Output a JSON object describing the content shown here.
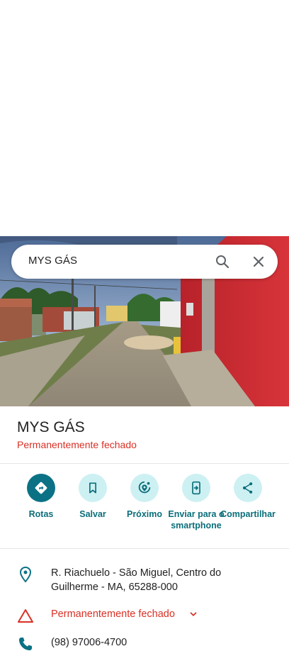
{
  "search": {
    "query": "MYS GÁS"
  },
  "place": {
    "name": "MYS GÁS",
    "status": "Permanentemente fechado"
  },
  "actions": [
    {
      "label": "Rotas",
      "icon": "directions-icon"
    },
    {
      "label": "Salvar",
      "icon": "bookmark-icon"
    },
    {
      "label": "Próximo",
      "icon": "nearby-icon"
    },
    {
      "label": "Enviar para o smartphone",
      "icon": "send-to-phone-icon"
    },
    {
      "label": "Compartilhar",
      "icon": "share-icon"
    }
  ],
  "info": {
    "address": "R. Riachuelo - São Miguel, Centro do Guilherme - MA, 65288-000",
    "closed_status": "Permanentemente fechado",
    "phone": "(98) 97006-4700"
  },
  "colors": {
    "accent": "#0b7285",
    "accent_light": "#cdf0f3",
    "closed_red": "#d93025"
  }
}
